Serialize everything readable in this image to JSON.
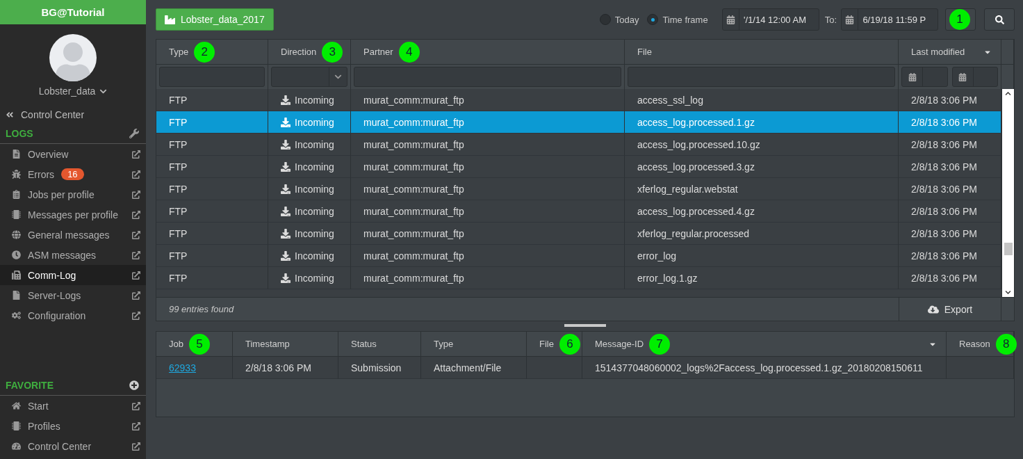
{
  "sidebar": {
    "brand": "BG@Tutorial",
    "user": "Lobster_data",
    "back_link": "Control Center",
    "logs_section": {
      "title": "LOGS",
      "items": [
        {
          "label": "Overview",
          "selected": false
        },
        {
          "label": "Errors",
          "badge": "16",
          "selected": false
        },
        {
          "label": "Jobs per profile",
          "selected": false
        },
        {
          "label": "Messages per profile",
          "selected": false
        },
        {
          "label": "General messages",
          "selected": false
        },
        {
          "label": "ASM messages",
          "selected": false
        },
        {
          "label": "Comm-Log",
          "selected": true
        },
        {
          "label": "Server-Logs",
          "selected": false
        },
        {
          "label": "Configuration",
          "selected": false
        }
      ]
    },
    "favorite_section": {
      "title": "FAVORITE",
      "items": [
        {
          "label": "Start",
          "selected": false
        },
        {
          "label": "Profiles",
          "selected": false
        },
        {
          "label": "Control Center",
          "selected": false
        }
      ]
    }
  },
  "toolbar": {
    "profile_button": "Lobster_data_2017",
    "range_options": [
      {
        "label": "Today",
        "selected": false
      },
      {
        "label": "Time frame",
        "selected": true
      }
    ],
    "from_value": "'/1/14 12:00 AM",
    "to_label": "To:",
    "to_value": "6/19/18 11:59 P",
    "callout": "1"
  },
  "table": {
    "columns": [
      {
        "label": "Type",
        "callout": "2",
        "sorted": false,
        "kind": "text"
      },
      {
        "label": "Direction",
        "callout": "3",
        "sorted": false,
        "kind": "select"
      },
      {
        "label": "Partner",
        "callout": "4",
        "sorted": false,
        "kind": "text"
      },
      {
        "label": "File",
        "sorted": false,
        "kind": "text"
      },
      {
        "label": "Last modified",
        "sorted": true,
        "kind": "dates"
      }
    ],
    "rows": [
      {
        "type": "FTP",
        "direction": "Incoming",
        "partner": "murat_comm:murat_ftp",
        "file": "access_ssl_log",
        "modified": "2/8/18 3:06 PM",
        "selected": false
      },
      {
        "type": "FTP",
        "direction": "Incoming",
        "partner": "murat_comm:murat_ftp",
        "file": "access_log.processed.1.gz",
        "modified": "2/8/18 3:06 PM",
        "selected": true
      },
      {
        "type": "FTP",
        "direction": "Incoming",
        "partner": "murat_comm:murat_ftp",
        "file": "access_log.processed.10.gz",
        "modified": "2/8/18 3:06 PM",
        "selected": false
      },
      {
        "type": "FTP",
        "direction": "Incoming",
        "partner": "murat_comm:murat_ftp",
        "file": "access_log.processed.3.gz",
        "modified": "2/8/18 3:06 PM",
        "selected": false
      },
      {
        "type": "FTP",
        "direction": "Incoming",
        "partner": "murat_comm:murat_ftp",
        "file": "xferlog_regular.webstat",
        "modified": "2/8/18 3:06 PM",
        "selected": false
      },
      {
        "type": "FTP",
        "direction": "Incoming",
        "partner": "murat_comm:murat_ftp",
        "file": "access_log.processed.4.gz",
        "modified": "2/8/18 3:06 PM",
        "selected": false
      },
      {
        "type": "FTP",
        "direction": "Incoming",
        "partner": "murat_comm:murat_ftp",
        "file": "xferlog_regular.processed",
        "modified": "2/8/18 3:06 PM",
        "selected": false
      },
      {
        "type": "FTP",
        "direction": "Incoming",
        "partner": "murat_comm:murat_ftp",
        "file": "error_log",
        "modified": "2/8/18 3:06 PM",
        "selected": false
      },
      {
        "type": "FTP",
        "direction": "Incoming",
        "partner": "murat_comm:murat_ftp",
        "file": "error_log.1.gz",
        "modified": "2/8/18 3:06 PM",
        "selected": false
      }
    ],
    "count": "99 entries found",
    "export": "Export"
  },
  "detail_table": {
    "columns": [
      {
        "label": "Job",
        "callout": "5",
        "sorted": false
      },
      {
        "label": "Timestamp",
        "sorted": false
      },
      {
        "label": "Status",
        "sorted": false
      },
      {
        "label": "Type",
        "sorted": false
      },
      {
        "label": "File",
        "callout": "6",
        "sorted": false
      },
      {
        "label": "Message-ID",
        "callout": "7",
        "sorted": true
      },
      {
        "label": "Reason",
        "callout": "8",
        "sorted": false
      }
    ],
    "rows": [
      {
        "job": "62933",
        "timestamp": "2/8/18 3:06 PM",
        "status": "Submission",
        "type": "Attachment/File",
        "message_id": "1514377048060002_logs%2Faccess_log.processed.1.gz_20180208150611"
      }
    ]
  }
}
